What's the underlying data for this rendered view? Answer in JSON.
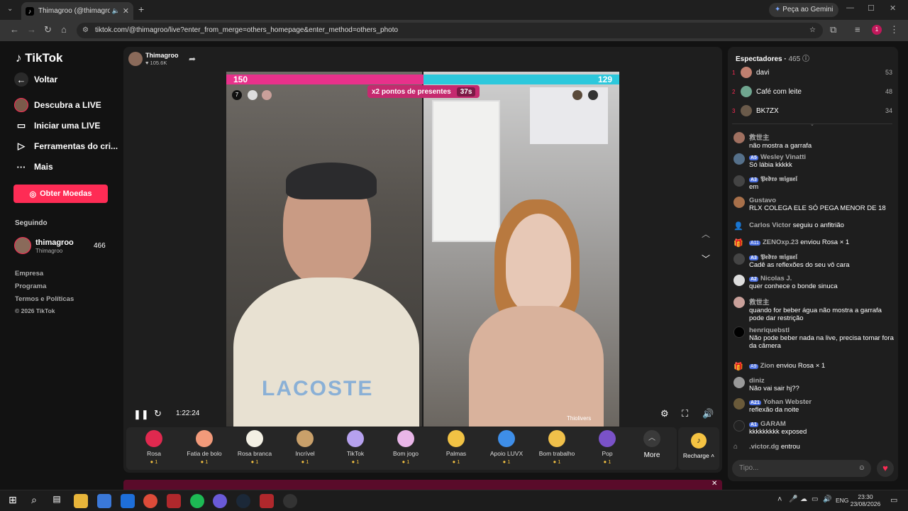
{
  "browser": {
    "tab_title": "Thimagroo (@thimagroo) é",
    "url": "tiktok.com/@thimagroo/live?enter_from_merge=others_homepage&enter_method=others_photo",
    "gemini_label": "Peça ao Gemini"
  },
  "sidebar": {
    "logo": "TikTok",
    "back": "Voltar",
    "items": [
      {
        "label": "Descubra a LIVE",
        "icon": "live-discover-icon"
      },
      {
        "label": "Iniciar uma LIVE",
        "icon": "camera-icon"
      },
      {
        "label": "Ferramentas do cri...",
        "icon": "creator-tools-icon"
      },
      {
        "label": "Mais",
        "icon": "more-icon"
      }
    ],
    "coins_button": "Obter Moedas",
    "following_header": "Seguindo",
    "following": {
      "name": "thimagroo",
      "sub": "Thimagroo",
      "count": "466"
    },
    "footer_links": [
      "Empresa",
      "Programa",
      "Termos e Políticas",
      "© 2026 TikTok"
    ]
  },
  "player": {
    "host_name": "Thimagroo",
    "host_likes": "105.6K",
    "score_left": "150",
    "score_right": "129",
    "bonus_label": "x2 pontos de presentes",
    "bonus_timer": "37s",
    "opponent_name": "Thiolivers",
    "elapsed": "1:22:24"
  },
  "gifts": [
    {
      "name": "Rosa",
      "price": "1",
      "color": "#e0294f"
    },
    {
      "name": "Fatia de bolo",
      "price": "1",
      "color": "#f29a7a"
    },
    {
      "name": "Rosa branca",
      "price": "1",
      "color": "#f3f0e4"
    },
    {
      "name": "Incrível",
      "price": "1",
      "color": "#c9a06a"
    },
    {
      "name": "TikTok",
      "price": "1",
      "color": "#b6a1ee"
    },
    {
      "name": "Bom jogo",
      "price": "1",
      "color": "#e9b6e8"
    },
    {
      "name": "Palmas",
      "price": "1",
      "color": "#f1c244"
    },
    {
      "name": "Apoio LUVX",
      "price": "1",
      "color": "#3e8ee8"
    },
    {
      "name": "Bom trabalho",
      "price": "1",
      "color": "#f0c04a"
    },
    {
      "name": "Pop",
      "price": "1",
      "color": "#7a52c8"
    }
  ],
  "gift_more": "More",
  "recharge": "Recharge",
  "viewers": {
    "title": "Espectadores",
    "count": "465",
    "top": [
      {
        "rank": "1",
        "name": "davi",
        "score": "53"
      },
      {
        "rank": "2",
        "name": "Café com leite",
        "score": "48"
      },
      {
        "rank": "3",
        "name": "BK7ZX",
        "score": "34"
      }
    ]
  },
  "chat": [
    {
      "user": "救世主",
      "level": "",
      "text": "não mostra a garrafa"
    },
    {
      "user": "Wesley Vinatti",
      "level": "5",
      "text": "Só lábia kkkkk"
    },
    {
      "user": "𝕻𝖊𝖉𝖗𝖔 𝖒𝖎𝖌𝖚𝖊𝖑",
      "level": "3",
      "text": "em"
    },
    {
      "user": "Gustavo",
      "level": "",
      "text": "RLX COLEGA ELE SÓ PEGA MENOR DE 18"
    },
    {
      "user": "Carlos Victor",
      "level": "",
      "text": "seguiu o anfitrião"
    },
    {
      "user": "ZENOxp.23",
      "level": "11",
      "text": "enviou Rosa × 1"
    },
    {
      "user": "𝕻𝖊𝖉𝖗𝖔 𝖒𝖎𝖌𝖚𝖊𝖑",
      "level": "3",
      "text": "Cadê as reflexões do seu vô cara"
    },
    {
      "user": "Nicolas J.",
      "level": "2",
      "text": "quer conhece o bonde sinuca"
    },
    {
      "user": "救世主",
      "level": "",
      "text": "quando for beber água não mostra a garrafa pode dar restrição"
    },
    {
      "user": "henriquebstl",
      "level": "",
      "text": "Não pode beber nada na live, precisa tomar fora da câmera"
    },
    {
      "user": "Zion",
      "level": "9",
      "text": "enviou Rosa × 1"
    },
    {
      "user": "diniz",
      "level": "",
      "text": "Não vai sair hj??"
    },
    {
      "user": "Yohan Webster",
      "level": "21",
      "text": "reflexão da noite"
    },
    {
      "user": "GARAM",
      "level": "1",
      "text": "kkkkkkkkk exposed"
    },
    {
      "user": ".victor.dg",
      "level": "",
      "text": "entrou"
    }
  ],
  "chat_placeholder": "Tipo...",
  "taskbar": {
    "lang": "ENG",
    "time": "23:30",
    "date": "23/08/2026"
  }
}
